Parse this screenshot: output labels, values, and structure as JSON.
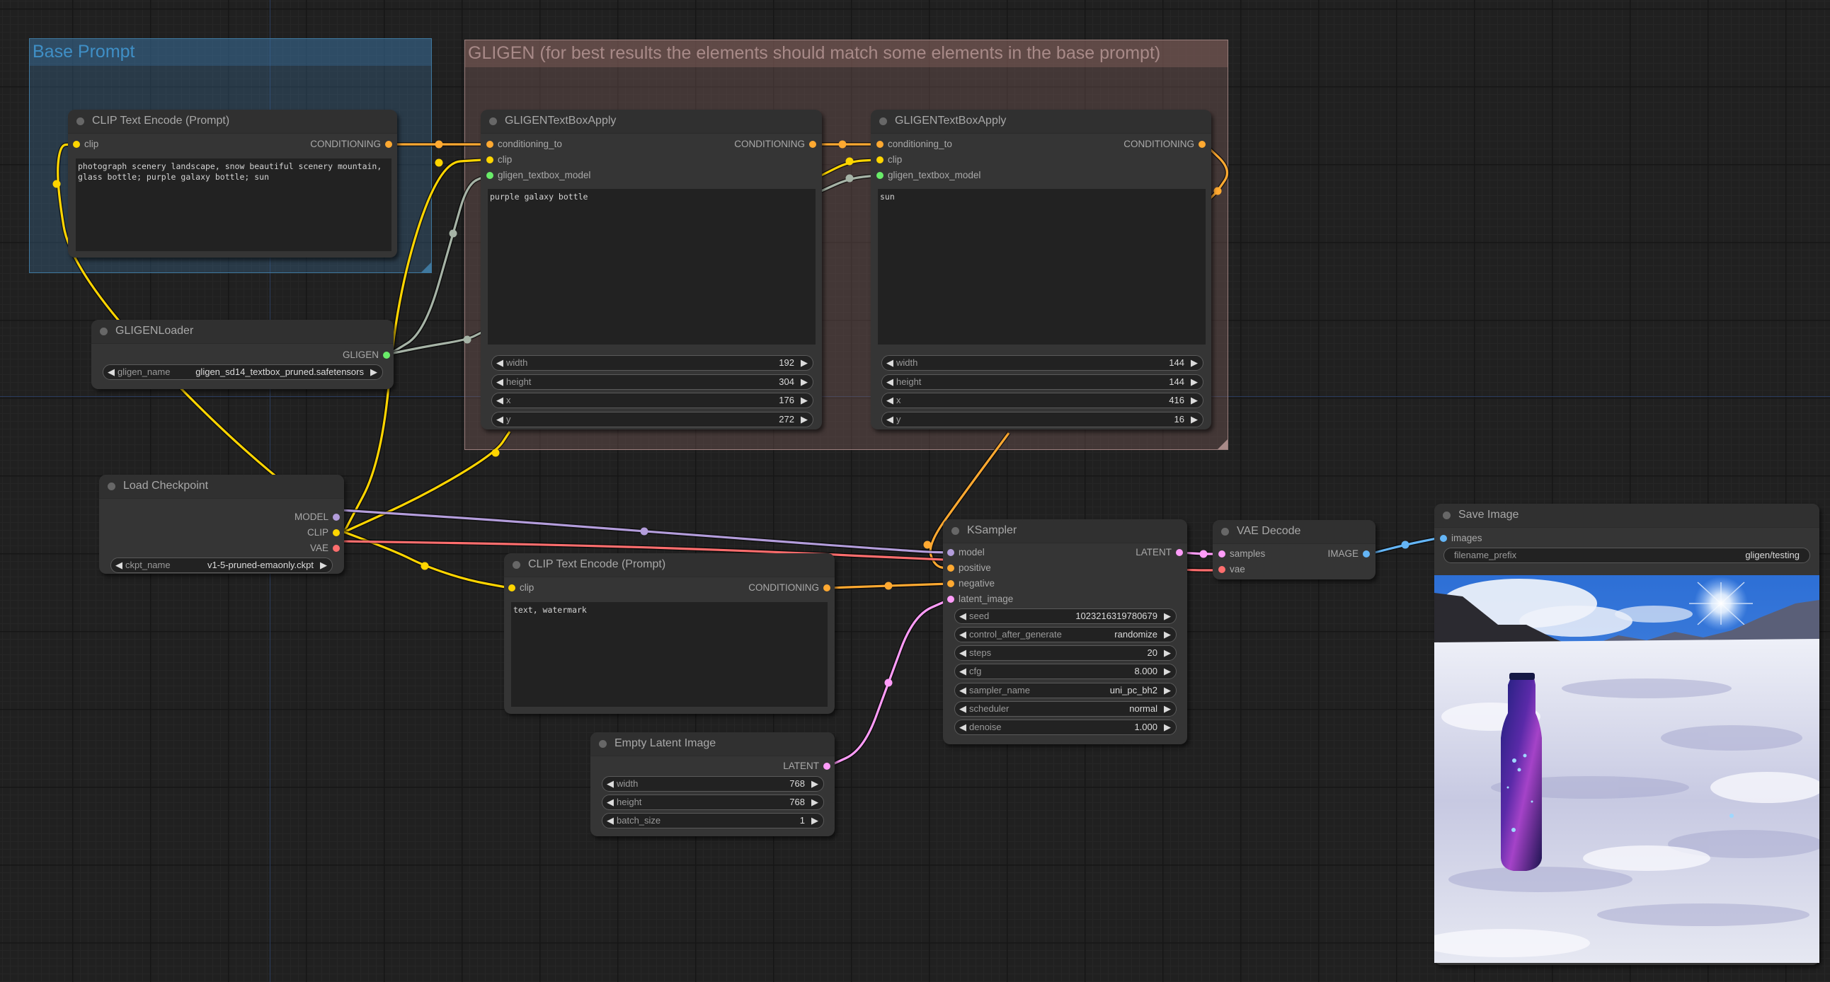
{
  "colors": {
    "clip": "#ffd500",
    "conditioning": "#ffa931",
    "gligen": "#69ec69",
    "model": "#b39ddb",
    "vae": "#ff6e6e",
    "latent": "#ff9cf9",
    "image": "#64b5f6",
    "gligen_link": "#a6b3a6"
  },
  "groups": {
    "base": {
      "title": "Base Prompt"
    },
    "gligen": {
      "title": "GLIGEN (for best results the elements should match some elements in the base prompt)"
    }
  },
  "nodes": {
    "clip_pos": {
      "title": "CLIP Text Encode (Prompt)",
      "inputs": [
        "clip"
      ],
      "outputs": [
        "CONDITIONING"
      ],
      "text": "photograph scenery landscape, snow beautiful scenery mountain,\nglass bottle; purple galaxy bottle; sun"
    },
    "gligen_apply_1": {
      "title": "GLIGENTextBoxApply",
      "inputs": [
        "conditioning_to",
        "clip",
        "gligen_textbox_model"
      ],
      "outputs": [
        "CONDITIONING"
      ],
      "text": "purple galaxy bottle",
      "widgets": [
        {
          "label": "width",
          "value": "192"
        },
        {
          "label": "height",
          "value": "304"
        },
        {
          "label": "x",
          "value": "176"
        },
        {
          "label": "y",
          "value": "272"
        }
      ]
    },
    "gligen_apply_2": {
      "title": "GLIGENTextBoxApply",
      "inputs": [
        "conditioning_to",
        "clip",
        "gligen_textbox_model"
      ],
      "outputs": [
        "CONDITIONING"
      ],
      "text": "sun",
      "widgets": [
        {
          "label": "width",
          "value": "144"
        },
        {
          "label": "height",
          "value": "144"
        },
        {
          "label": "x",
          "value": "416"
        },
        {
          "label": "y",
          "value": "16"
        }
      ]
    },
    "gligen_loader": {
      "title": "GLIGENLoader",
      "outputs": [
        "GLIGEN"
      ],
      "widgets": [
        {
          "label": "gligen_name",
          "value": "gligen_sd14_textbox_pruned.safetensors"
        }
      ]
    },
    "load_checkpoint": {
      "title": "Load Checkpoint",
      "outputs": [
        "MODEL",
        "CLIP",
        "VAE"
      ],
      "widgets": [
        {
          "label": "ckpt_name",
          "value": "v1-5-pruned-emaonly.ckpt"
        }
      ]
    },
    "clip_neg": {
      "title": "CLIP Text Encode (Prompt)",
      "inputs": [
        "clip"
      ],
      "outputs": [
        "CONDITIONING"
      ],
      "text": "text, watermark"
    },
    "empty_latent": {
      "title": "Empty Latent Image",
      "outputs": [
        "LATENT"
      ],
      "widgets": [
        {
          "label": "width",
          "value": "768"
        },
        {
          "label": "height",
          "value": "768"
        },
        {
          "label": "batch_size",
          "value": "1"
        }
      ]
    },
    "ksampler": {
      "title": "KSampler",
      "inputs": [
        "model",
        "positive",
        "negative",
        "latent_image"
      ],
      "outputs": [
        "LATENT"
      ],
      "widgets": [
        {
          "label": "seed",
          "value": "1023216319780679"
        },
        {
          "label": "control_after_generate",
          "value": "randomize"
        },
        {
          "label": "steps",
          "value": "20"
        },
        {
          "label": "cfg",
          "value": "8.000"
        },
        {
          "label": "sampler_name",
          "value": "uni_pc_bh2"
        },
        {
          "label": "scheduler",
          "value": "normal"
        },
        {
          "label": "denoise",
          "value": "1.000"
        }
      ]
    },
    "vae_decode": {
      "title": "VAE Decode",
      "inputs": [
        "samples",
        "vae"
      ],
      "outputs": [
        "IMAGE"
      ]
    },
    "save_image": {
      "title": "Save Image",
      "inputs": [
        "images"
      ],
      "widgets": [
        {
          "label": "filename_prefix",
          "value": "gligen/testing"
        }
      ],
      "preview_alt": "Generated image: purple galaxy bottle standing in snow, mountains and sun in blue sky"
    }
  },
  "icons": {
    "arrow_left": "◀",
    "arrow_right": "▶"
  }
}
